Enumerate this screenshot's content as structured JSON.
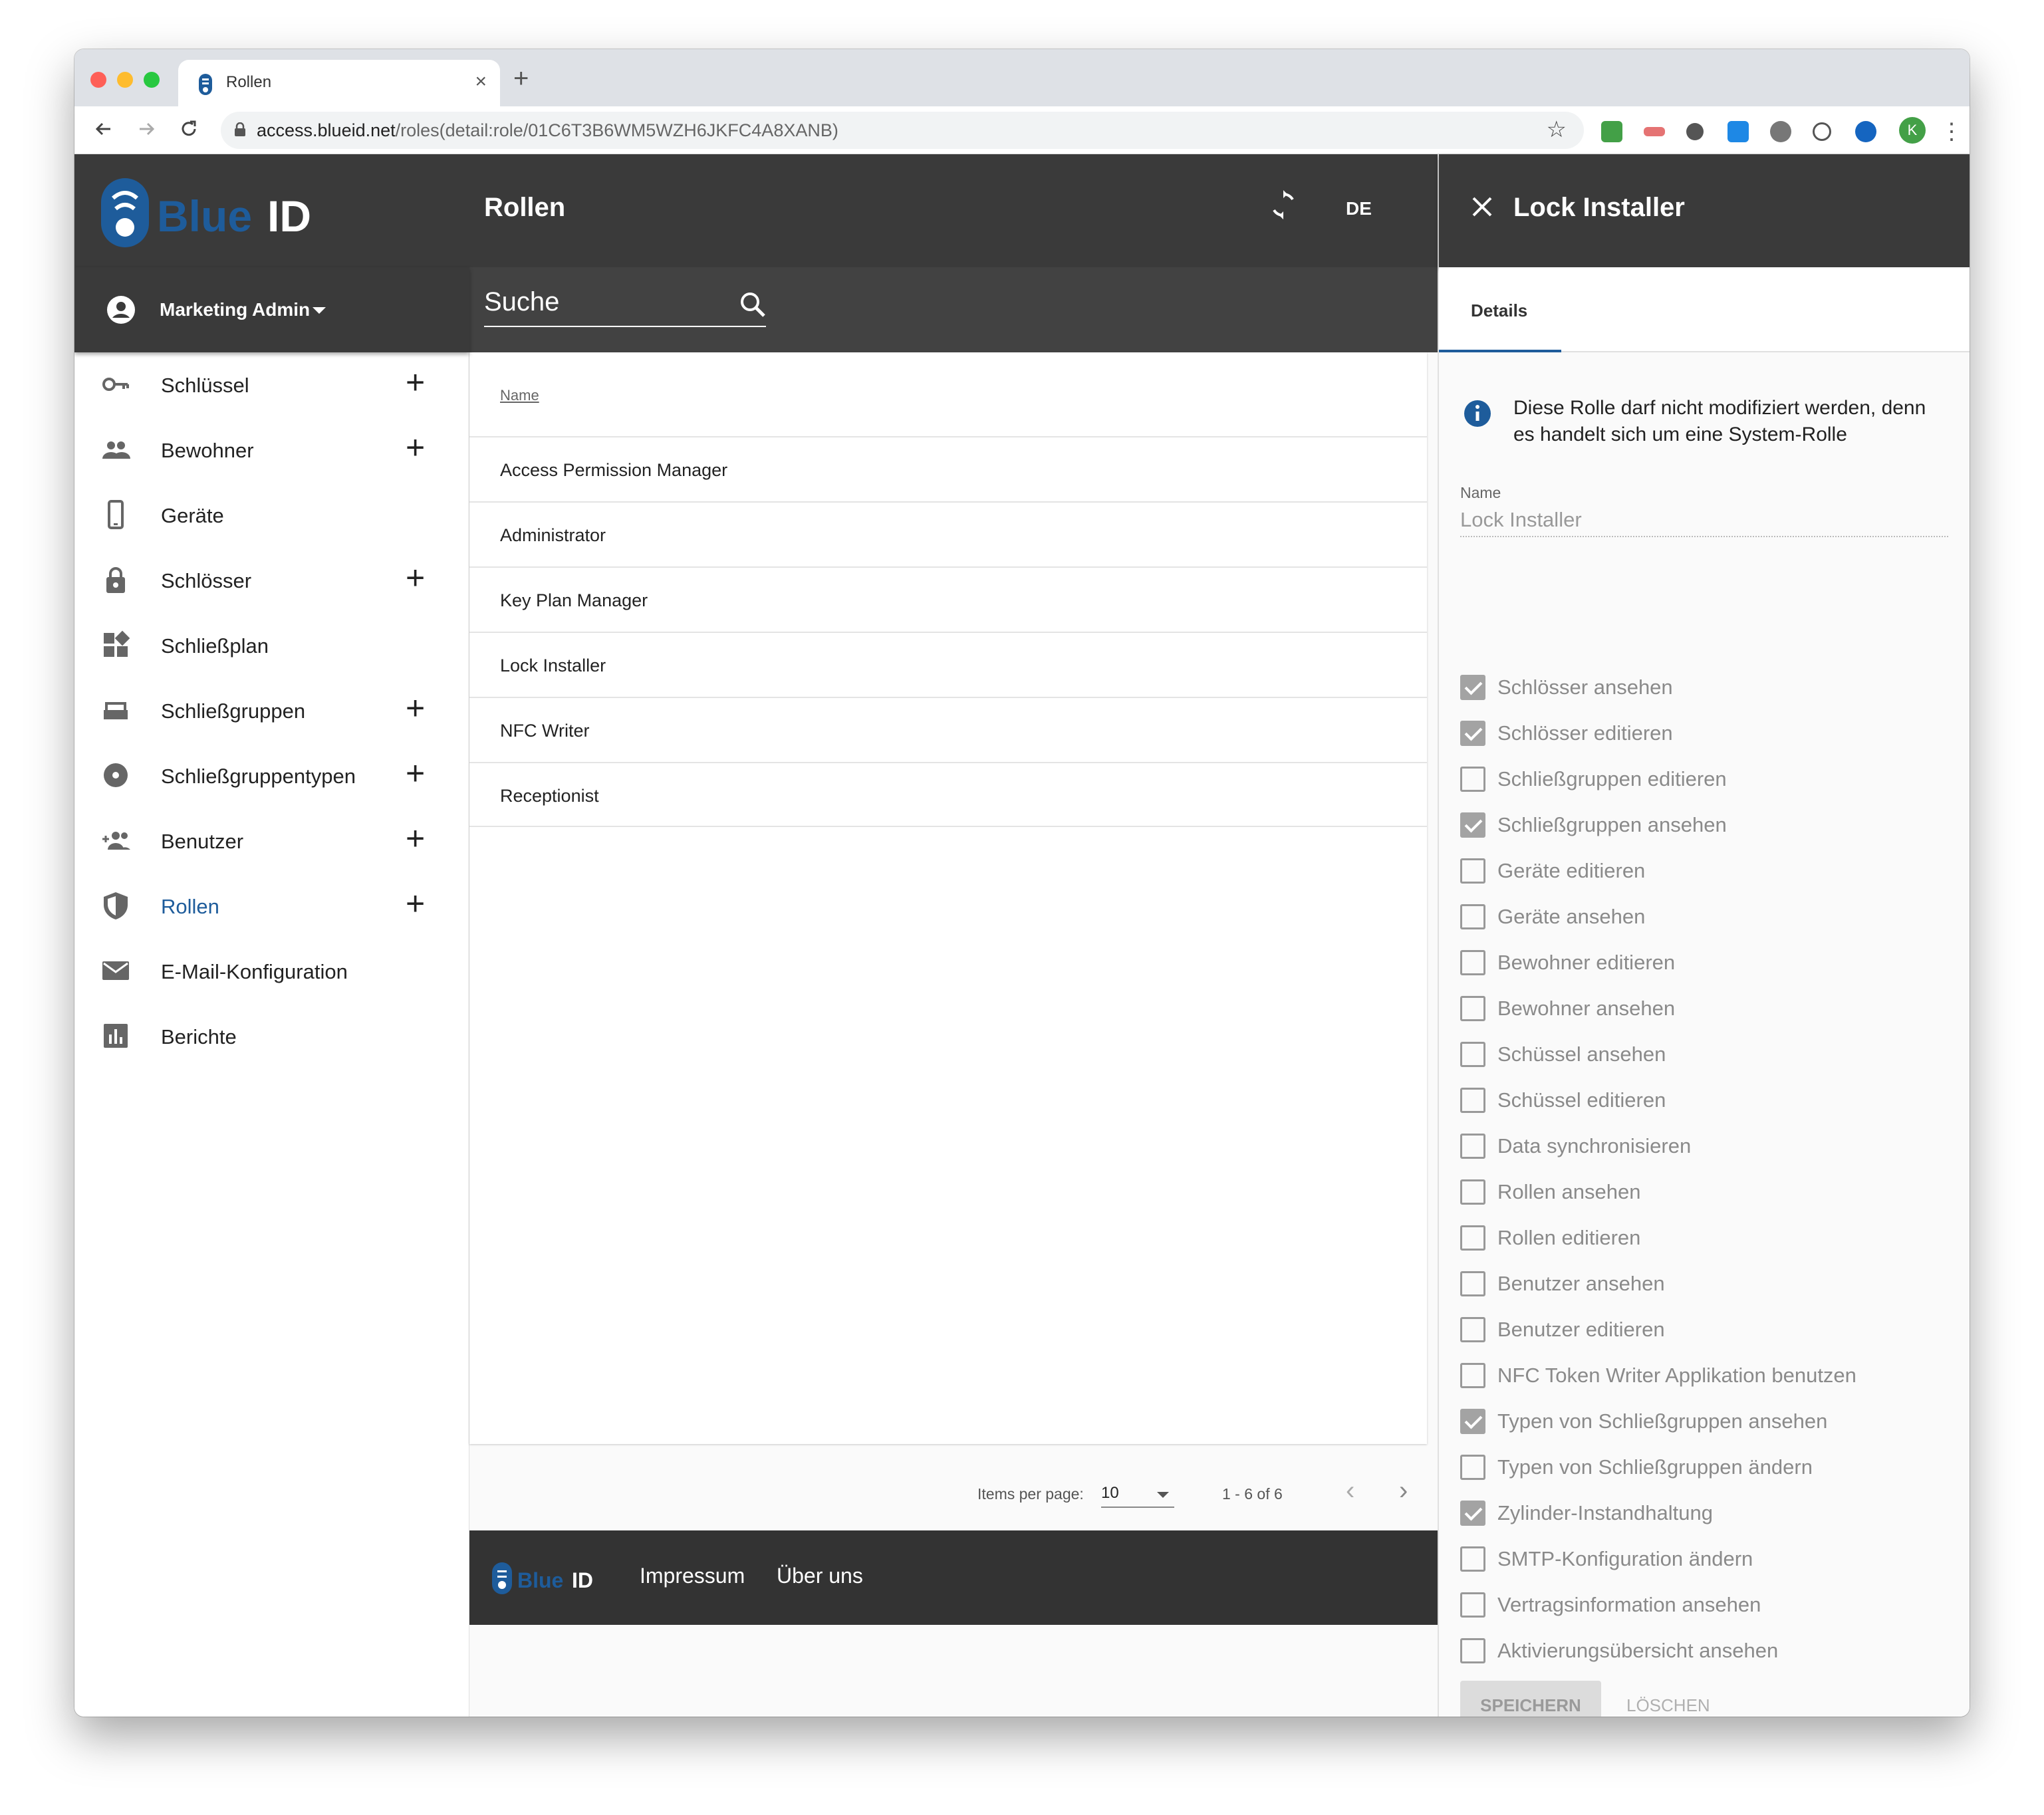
{
  "browser": {
    "tab_title": "Rollen",
    "url_host": "access.blueid.net",
    "url_path": "/roles(detail:role/01C6T3B6WM5WZH6JKFC4A8XANB)",
    "profile_initial": "K"
  },
  "header": {
    "logo_text": "BlueID",
    "page_title": "Rollen",
    "lang": "DE"
  },
  "user": {
    "name": "Marketing Admin"
  },
  "search": {
    "label": "Suche"
  },
  "nav": [
    {
      "label": "Schlüssel",
      "icon": "key-icon",
      "plus": true
    },
    {
      "label": "Bewohner",
      "icon": "people-icon",
      "plus": true
    },
    {
      "label": "Geräte",
      "icon": "phone-icon",
      "plus": false
    },
    {
      "label": "Schlösser",
      "icon": "lock-icon",
      "plus": true
    },
    {
      "label": "Schließplan",
      "icon": "dashboard-icon",
      "plus": false
    },
    {
      "label": "Schließgruppen",
      "icon": "tray-icon",
      "plus": true
    },
    {
      "label": "Schließgruppentypen",
      "icon": "disc-icon",
      "plus": true
    },
    {
      "label": "Benutzer",
      "icon": "group-add-icon",
      "plus": true
    },
    {
      "label": "Rollen",
      "icon": "shield-icon",
      "plus": true,
      "active": true
    },
    {
      "label": "E-Mail-Konfiguration",
      "icon": "mail-icon",
      "plus": false
    },
    {
      "label": "Berichte",
      "icon": "chart-icon",
      "plus": false
    }
  ],
  "nav_plus": "+",
  "table": {
    "header": "Name",
    "rows": [
      "Access Permission Manager",
      "Administrator",
      "Key Plan Manager",
      "Lock Installer",
      "NFC Writer",
      "Receptionist"
    ]
  },
  "pager": {
    "items_per_page_label": "Items per page:",
    "items_per_page": "10",
    "range": "1 - 6 of 6",
    "prev": "‹",
    "next": "›"
  },
  "footer": {
    "impressum": "Impressum",
    "about": "Über uns"
  },
  "panel": {
    "title": "Lock Installer",
    "tab": "Details",
    "info": "Diese Rolle darf nicht modifiziert werden, denn es handelt sich um eine System-Rolle",
    "name_label": "Name",
    "name_value": "Lock Installer",
    "permissions": [
      {
        "label": "Schlösser ansehen",
        "checked": true
      },
      {
        "label": "Schlösser editieren",
        "checked": true
      },
      {
        "label": "Schließgruppen editieren",
        "checked": false
      },
      {
        "label": "Schließgruppen ansehen",
        "checked": true
      },
      {
        "label": "Geräte editieren",
        "checked": false
      },
      {
        "label": "Geräte ansehen",
        "checked": false
      },
      {
        "label": "Bewohner editieren",
        "checked": false
      },
      {
        "label": "Bewohner ansehen",
        "checked": false
      },
      {
        "label": "Schüssel ansehen",
        "checked": false
      },
      {
        "label": "Schüssel editieren",
        "checked": false
      },
      {
        "label": "Data synchronisieren",
        "checked": false
      },
      {
        "label": "Rollen ansehen",
        "checked": false
      },
      {
        "label": "Rollen editieren",
        "checked": false
      },
      {
        "label": "Benutzer ansehen",
        "checked": false
      },
      {
        "label": "Benutzer editieren",
        "checked": false
      },
      {
        "label": "NFC Token Writer Applikation benutzen",
        "checked": false
      },
      {
        "label": "Typen von Schließgruppen ansehen",
        "checked": true
      },
      {
        "label": "Typen von Schließgruppen ändern",
        "checked": false
      },
      {
        "label": "Zylinder-Instandhaltung",
        "checked": true
      },
      {
        "label": "SMTP-Konfiguration ändern",
        "checked": false
      },
      {
        "label": "Vertragsinformation ansehen",
        "checked": false
      },
      {
        "label": "Aktivierungsübersicht ansehen",
        "checked": false
      }
    ],
    "save": "SPEICHERN",
    "delete": "LÖSCHEN"
  },
  "colors": {
    "brand_blue": "#1e5c9b",
    "header_dark": "#3a3a3a"
  }
}
